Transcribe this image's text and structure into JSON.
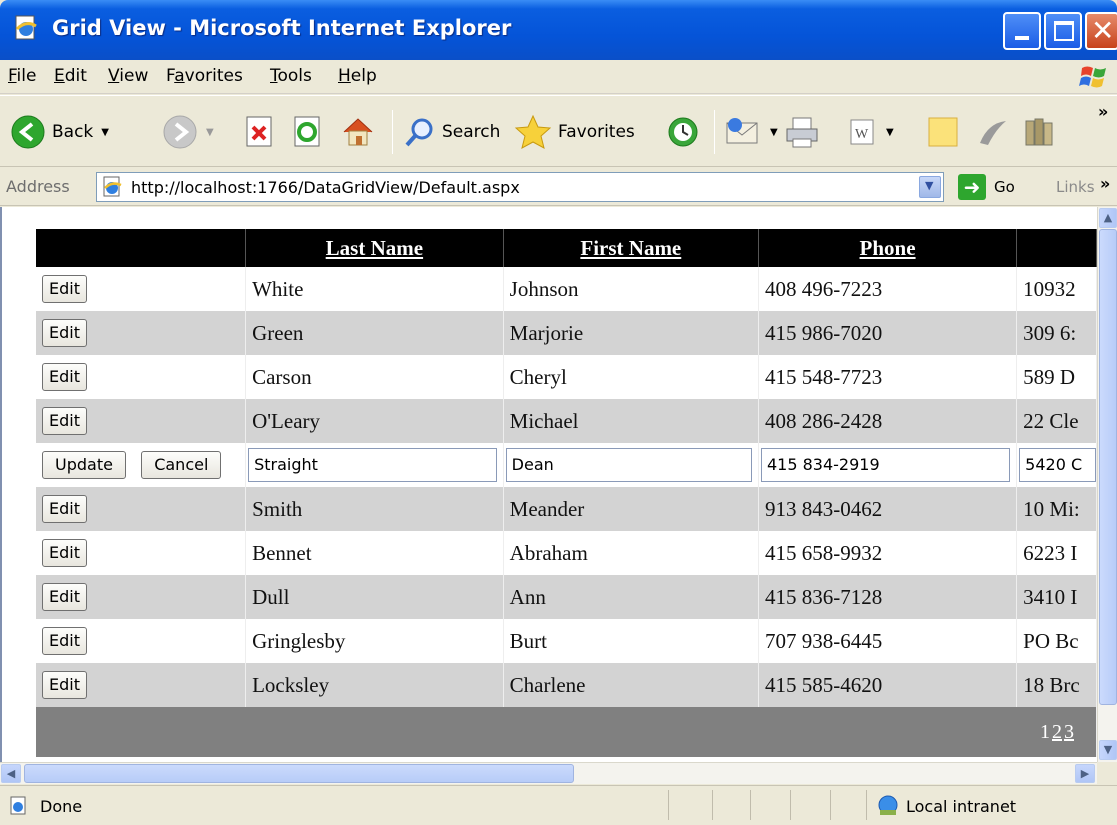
{
  "window": {
    "title": "Grid View - Microsoft Internet Explorer"
  },
  "menu": {
    "file": {
      "pre": "",
      "key": "F",
      "post": "ile"
    },
    "edit": {
      "pre": "",
      "key": "E",
      "post": "dit"
    },
    "view": {
      "pre": "",
      "key": "V",
      "post": "iew"
    },
    "favorites": {
      "pre": "F",
      "key": "a",
      "post": "vorites"
    },
    "tools": {
      "pre": "",
      "key": "T",
      "post": "ools"
    },
    "help": {
      "pre": "",
      "key": "H",
      "post": "elp"
    }
  },
  "toolbar": {
    "back_label": "Back",
    "search_label": "Search",
    "favorites_label": "Favorites",
    "overflow": "»"
  },
  "address": {
    "label": "Address",
    "url": "http://localhost:1766/DataGridView/Default.aspx",
    "go_label": "Go",
    "links_label": "Links",
    "overflow": "»"
  },
  "grid": {
    "columns": [
      "",
      "Last Name",
      "First Name",
      "Phone",
      ""
    ],
    "rows": [
      {
        "action": "Edit",
        "last": "White",
        "first": "Johnson",
        "phone": "408 496-7223",
        "addr": "10932"
      },
      {
        "action": "Edit",
        "last": "Green",
        "first": "Marjorie",
        "phone": "415 986-7020",
        "addr": "309 6:"
      },
      {
        "action": "Edit",
        "last": "Carson",
        "first": "Cheryl",
        "phone": "415 548-7723",
        "addr": "589 D"
      },
      {
        "action": "Edit",
        "last": "O'Leary",
        "first": "Michael",
        "phone": "408 286-2428",
        "addr": "22 Cle"
      },
      {
        "action": "Edit",
        "last": "Smith",
        "first": "Meander",
        "phone": "913 843-0462",
        "addr": "10 Mi:"
      },
      {
        "action": "Edit",
        "last": "Bennet",
        "first": "Abraham",
        "phone": "415 658-9932",
        "addr": "6223 I"
      },
      {
        "action": "Edit",
        "last": "Dull",
        "first": "Ann",
        "phone": "415 836-7128",
        "addr": "3410 I"
      },
      {
        "action": "Edit",
        "last": "Gringlesby",
        "first": "Burt",
        "phone": "707 938-6445",
        "addr": "PO Bc"
      },
      {
        "action": "Edit",
        "last": "Locksley",
        "first": "Charlene",
        "phone": "415 585-4620",
        "addr": "18 Brc"
      }
    ],
    "edit_row": {
      "update_label": "Update",
      "cancel_label": "Cancel",
      "last": "Straight",
      "first": "Dean",
      "phone": "415 834-2919",
      "addr": "5420 C"
    },
    "pager": {
      "current": "1",
      "pages": [
        "2",
        "3"
      ]
    }
  },
  "status": {
    "text": "Done",
    "zone": "Local intranet"
  },
  "colors": {
    "header_bg": "#000000",
    "alt_row_bg": "#d3d3d3",
    "pager_bg": "#808080",
    "titlebar": "#0554d8"
  }
}
